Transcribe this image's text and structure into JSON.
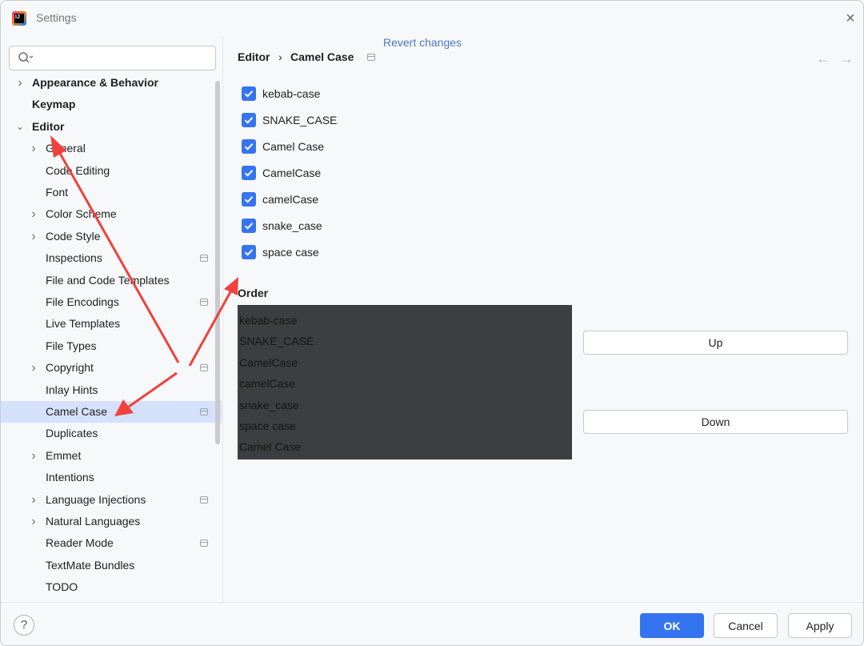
{
  "window": {
    "title": "Settings",
    "logo_text": "IJ"
  },
  "search": {
    "value": "",
    "placeholder": ""
  },
  "sidebar": {
    "items": [
      {
        "label": "Appearance & Behavior",
        "level": 0,
        "chevron": "right",
        "mark": false
      },
      {
        "label": "Keymap",
        "level": 0,
        "chevron": "",
        "mark": false
      },
      {
        "label": "Editor",
        "level": 0,
        "chevron": "down",
        "mark": false
      },
      {
        "label": "General",
        "level": 1,
        "chevron": "right",
        "mark": false
      },
      {
        "label": "Code Editing",
        "level": 1,
        "chevron": "",
        "mark": false
      },
      {
        "label": "Font",
        "level": 1,
        "chevron": "",
        "mark": false
      },
      {
        "label": "Color Scheme",
        "level": 1,
        "chevron": "right",
        "mark": false
      },
      {
        "label": "Code Style",
        "level": 1,
        "chevron": "right",
        "mark": false
      },
      {
        "label": "Inspections",
        "level": 1,
        "chevron": "",
        "mark": true
      },
      {
        "label": "File and Code Templates",
        "level": 1,
        "chevron": "",
        "mark": false
      },
      {
        "label": "File Encodings",
        "level": 1,
        "chevron": "",
        "mark": true
      },
      {
        "label": "Live Templates",
        "level": 1,
        "chevron": "",
        "mark": false
      },
      {
        "label": "File Types",
        "level": 1,
        "chevron": "",
        "mark": false
      },
      {
        "label": "Copyright",
        "level": 1,
        "chevron": "right",
        "mark": true
      },
      {
        "label": "Inlay Hints",
        "level": 1,
        "chevron": "",
        "mark": false
      },
      {
        "label": "Camel Case",
        "level": 1,
        "chevron": "",
        "mark": true,
        "selected": true
      },
      {
        "label": "Duplicates",
        "level": 1,
        "chevron": "",
        "mark": false
      },
      {
        "label": "Emmet",
        "level": 1,
        "chevron": "right",
        "mark": false
      },
      {
        "label": "Intentions",
        "level": 1,
        "chevron": "",
        "mark": false
      },
      {
        "label": "Language Injections",
        "level": 1,
        "chevron": "right",
        "mark": true
      },
      {
        "label": "Natural Languages",
        "level": 1,
        "chevron": "right",
        "mark": false
      },
      {
        "label": "Reader Mode",
        "level": 1,
        "chevron": "",
        "mark": true
      },
      {
        "label": "TextMate Bundles",
        "level": 1,
        "chevron": "",
        "mark": false
      },
      {
        "label": "TODO",
        "level": 1,
        "chevron": "",
        "mark": false
      }
    ]
  },
  "content": {
    "breadcrumb": [
      "Editor",
      "›",
      "Camel Case"
    ],
    "revert_label": "Revert changes",
    "checkboxes": [
      {
        "label": "kebab-case",
        "checked": true
      },
      {
        "label": "SNAKE_CASE",
        "checked": true
      },
      {
        "label": "Camel Case",
        "checked": true
      },
      {
        "label": "CamelCase",
        "checked": true
      },
      {
        "label": "camelCase",
        "checked": true
      },
      {
        "label": "snake_case",
        "checked": true
      },
      {
        "label": "space case",
        "checked": true
      }
    ],
    "order_title": "Order",
    "order_items": [
      "kebab-case",
      "SNAKE_CASE",
      "CamelCase",
      "camelCase",
      "snake_case",
      "space case",
      "Camel Case"
    ],
    "up_label": "Up",
    "down_label": "Down"
  },
  "footer": {
    "help_label": "?",
    "ok_label": "OK",
    "cancel_label": "Cancel",
    "apply_label": "Apply"
  },
  "colors": {
    "accent": "#3574f0",
    "selection": "#d5e1fb",
    "annotation_arrow": "#f0413c",
    "order_list_bg": "#3c3f41"
  }
}
